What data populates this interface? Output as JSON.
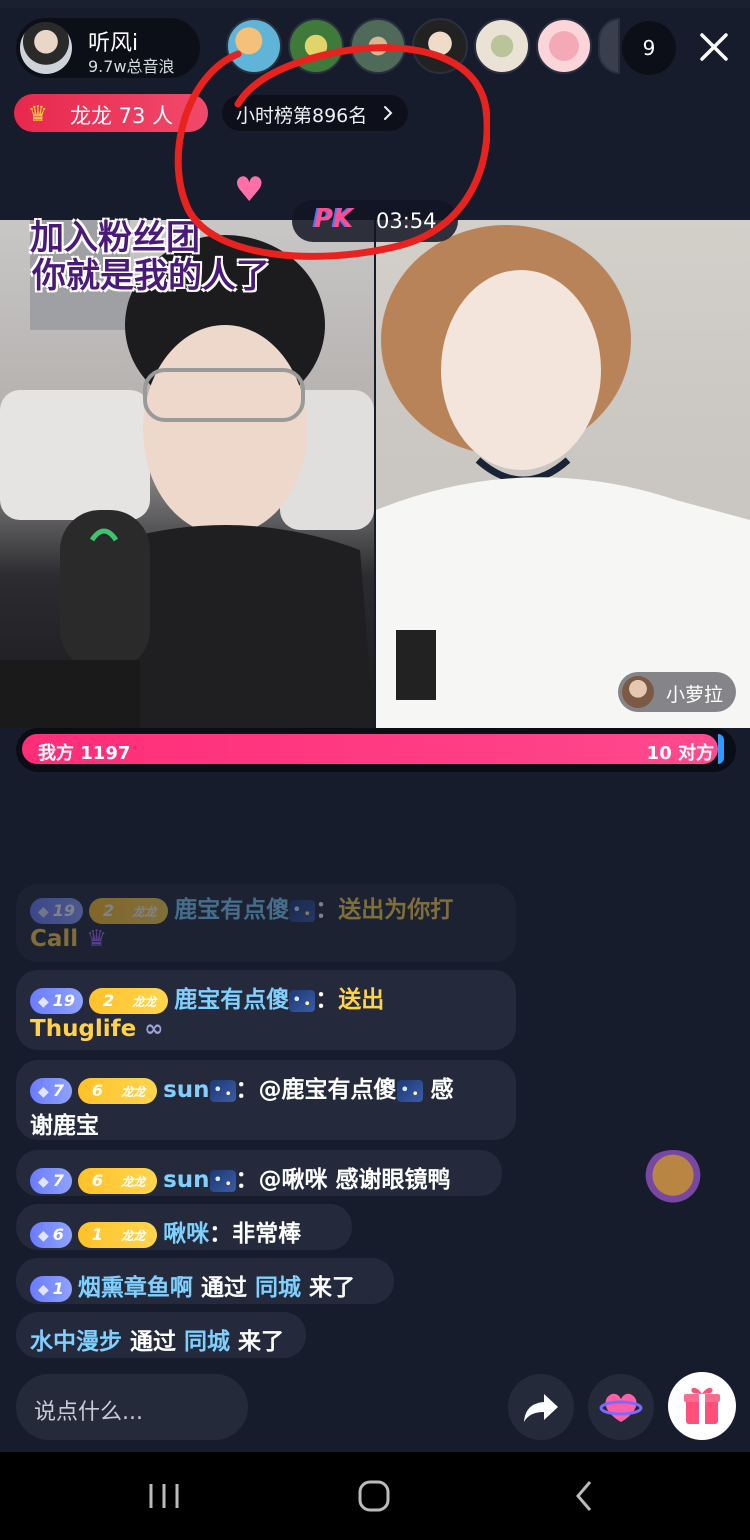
{
  "host": {
    "name": "听风i",
    "subtitle": "9.7w总音浪"
  },
  "viewer_count": "9",
  "fan_group": {
    "label": "龙龙 73 人"
  },
  "rank": {
    "label": "小时榜第896名"
  },
  "pk": {
    "label": "PK",
    "time": "03:54"
  },
  "sticker": {
    "line1": "加入粉丝团",
    "line2": "你就是我的人了"
  },
  "opponent": {
    "name": "小萝拉"
  },
  "score": {
    "left_label": "我方 1197",
    "right_label": "10 对方",
    "left_value": 1197,
    "right_value": 10
  },
  "chat": [
    {
      "level": "19",
      "fan_level": "2",
      "fan_name": "龙龙",
      "user": "鹿宝有点傻",
      "sep": "：",
      "text": "送出为你打",
      "text2": "Call",
      "type": "gift",
      "faded": true
    },
    {
      "level": "19",
      "fan_level": "2",
      "fan_name": "龙龙",
      "user": "鹿宝有点傻",
      "sep": "：",
      "text": "送出",
      "text2": "Thuglife",
      "type": "gift"
    },
    {
      "level": "7",
      "fan_level": "6",
      "fan_name": "龙龙",
      "user": "sun",
      "sep": "：",
      "text": "@鹿宝有点傻",
      "text_tail": "感",
      "text2": "谢鹿宝",
      "type": "text"
    },
    {
      "level": "7",
      "fan_level": "6",
      "fan_name": "龙龙",
      "user": "sun",
      "sep": "：",
      "text": "@啾咪 感谢眼镜鸭",
      "type": "text"
    },
    {
      "level": "6",
      "fan_level": "1",
      "fan_name": "龙龙",
      "user": "啾咪",
      "sep": "：",
      "text": "非常棒",
      "type": "text"
    },
    {
      "level": "1",
      "user": "烟熏章鱼啊",
      "via": "通过",
      "channel": "同城",
      "action": "来了",
      "type": "join"
    },
    {
      "user": "水中漫步",
      "via": "通过",
      "channel": "同城",
      "action": "来了",
      "type": "join"
    }
  ],
  "input": {
    "placeholder": "说点什么..."
  },
  "icons": [
    "close-icon",
    "chevron-right-icon",
    "crown-icon",
    "share-icon",
    "heart-icon",
    "gift-icon",
    "recent-apps-icon",
    "home-icon",
    "back-icon"
  ],
  "colors": {
    "accent_pink": "#ff2d78",
    "username_blue": "#7fd0ff",
    "gift_yellow": "#ffd24a",
    "background": "#171c2c"
  }
}
